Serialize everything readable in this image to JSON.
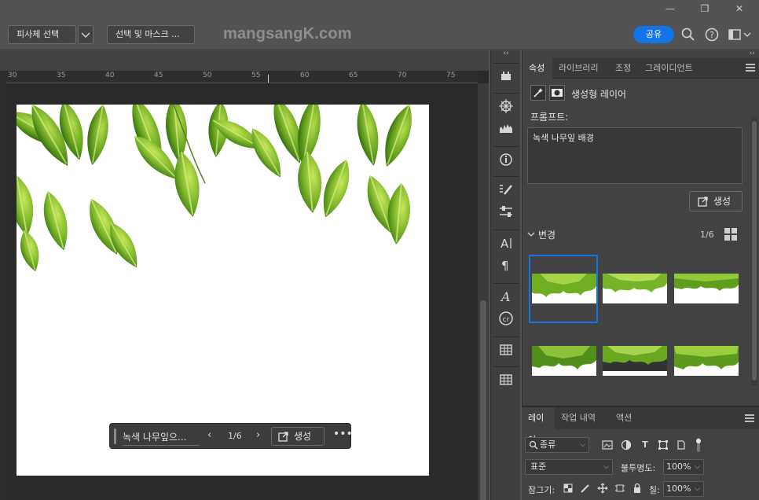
{
  "window": {
    "minimize": "—",
    "restore": "❐",
    "close": "✕"
  },
  "options_bar": {
    "select_subject": "피사체 선택",
    "select_mask": "선택 및 마스크 ...",
    "watermark": "mangsangK.com",
    "share": "공유"
  },
  "ruler": {
    "labels": [
      "30",
      "35",
      "40",
      "45",
      "50",
      "55",
      "60",
      "65",
      "70",
      "75"
    ]
  },
  "taskbar": {
    "prompt": "녹색 나무잎으...",
    "count": "1/6",
    "prev": "‹",
    "next": "›",
    "generate": "생성",
    "more": "•••"
  },
  "toolstrip": {
    "collapse": "‹‹",
    "tools": [
      "image-icon",
      "navigator-icon",
      "histogram-icon",
      "info-icon",
      "brush-settings-icon",
      "adjustments-icon",
      "character-icon",
      "paragraph-icon",
      "glyphs-icon",
      "content-credentials-icon",
      "grid-icon",
      "table-icon"
    ]
  },
  "properties": {
    "collapse": "››",
    "tabs": [
      "속성",
      "라이브러리",
      "조정",
      "그레이디언트"
    ],
    "active_tab": "속성",
    "layer_type": "생성형 레이어",
    "prompt_label": "프롬프트:",
    "prompt_text": "녹색 나무잎 배경",
    "generate": "생성",
    "variations_title": "변경",
    "variations_count": "1/6",
    "selected_variation": 1
  },
  "layers": {
    "tabs": [
      "레이어",
      "작업 내역",
      "액션"
    ],
    "active_tab": "레이어",
    "filter": "종류",
    "blend_mode": "표준",
    "opacity_label": "불투명도:",
    "opacity_value": "100%",
    "lock_label": "잠그기:",
    "fill_label": "칠:",
    "fill_value": "100%"
  },
  "colors": {
    "accent": "#1473e6",
    "panel_bg": "#424242",
    "canvas_bg": "#2a2a2a"
  }
}
